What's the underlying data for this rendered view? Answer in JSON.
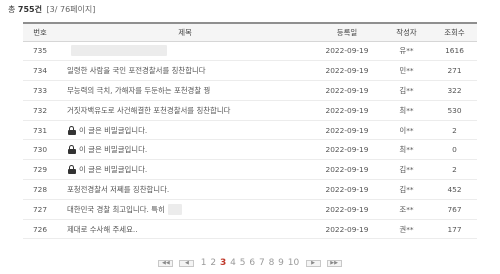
{
  "summary": {
    "prefix": "총",
    "count": "755건",
    "page_info": "[3/ 76페이지]"
  },
  "columns": {
    "no": "번호",
    "title": "제목",
    "date": "등록일",
    "author": "작성자",
    "views": "조회수"
  },
  "rows": [
    {
      "no": "735",
      "title": "",
      "date": "2022-09-19",
      "author": "유**",
      "views": "1616"
    },
    {
      "no": "734",
      "title": "일령한 사람을 국인 포전경찰서를 칭찬합니다",
      "date": "2022-09-19",
      "author": "민**",
      "views": "271"
    },
    {
      "no": "733",
      "title": "무능력의 극치, 가해자를 두둔하는 포천경찰 꿩",
      "date": "2022-09-19",
      "author": "김**",
      "views": "322"
    },
    {
      "no": "732",
      "title": "거짓자백유도로 사건해결한 포천경찰서를 칭찬합니다",
      "date": "2022-09-19",
      "author": "최**",
      "views": "530"
    },
    {
      "no": "731",
      "title": "이 글은 비밀글입니다.",
      "date": "2022-09-19",
      "author": "이**",
      "views": "2"
    },
    {
      "no": "730",
      "title": "이 글은 비밀글입니다.",
      "date": "2022-09-19",
      "author": "최**",
      "views": "0"
    },
    {
      "no": "729",
      "title": "이 글은 비밀글입니다.",
      "date": "2022-09-19",
      "author": "김**",
      "views": "2"
    },
    {
      "no": "728",
      "title": "포청전경찰서 저쩨를 징찬합니다.",
      "date": "2022-09-19",
      "author": "김**",
      "views": "452"
    },
    {
      "no": "727",
      "title": "대한민국 경찰 최고입니다. 특히",
      "date": "2022-09-19",
      "author": "조**",
      "views": "767"
    },
    {
      "no": "726",
      "title": "제대로 수사해 주세요..",
      "date": "2022-09-19",
      "author": "권**",
      "views": "177"
    }
  ],
  "pagination": {
    "first": "◀◀",
    "prev": "◀",
    "pages": [
      "1",
      "2",
      "3",
      "4",
      "5",
      "6",
      "7",
      "8",
      "9",
      "10"
    ],
    "current": "3",
    "next": "▶",
    "last": "▶▶"
  }
}
